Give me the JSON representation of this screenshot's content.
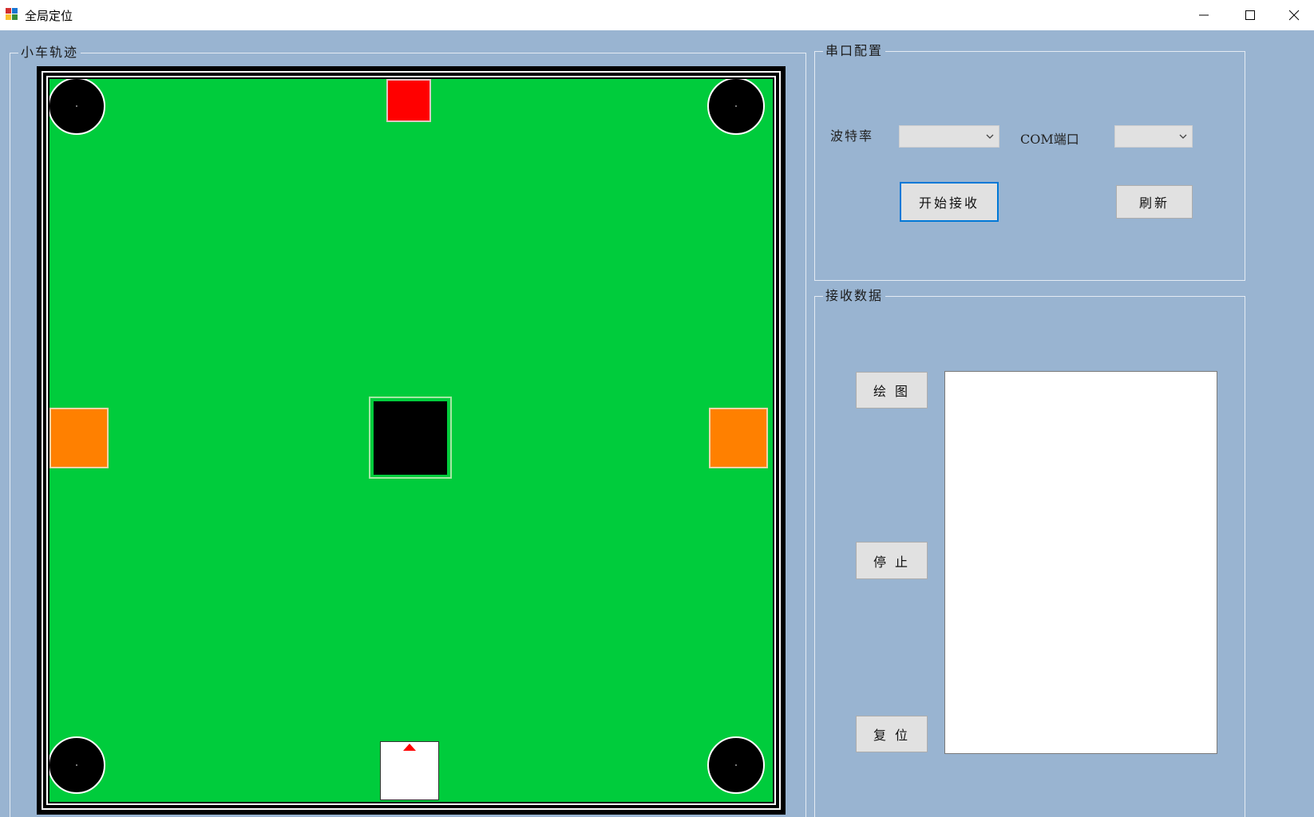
{
  "window": {
    "title": "全局定位",
    "icon": "app-window-icon",
    "controls": [
      "minimize-icon",
      "maximize-icon",
      "close-icon"
    ]
  },
  "groups": {
    "track": {
      "label": "小车轨迹"
    },
    "serial": {
      "label": "串口配置"
    },
    "receive": {
      "label": "接收数据"
    }
  },
  "serial": {
    "baud_label": "波特率",
    "baud_value": "",
    "com_label": "COM端口",
    "com_value": "",
    "start_button": "开始接收",
    "refresh_button": "刷新"
  },
  "receive": {
    "draw_button": "绘 图",
    "stop_button": "停 止",
    "reset_button": "复 位",
    "data_text": ""
  },
  "colors": {
    "window_bg": "#99b4d1",
    "field_green": "#00cc3c",
    "field_border": "#000000",
    "target_red": "#ff0000",
    "target_orange": "#ff8000",
    "car_marker": "#ff0000",
    "focus_accent": "#0078d7"
  }
}
